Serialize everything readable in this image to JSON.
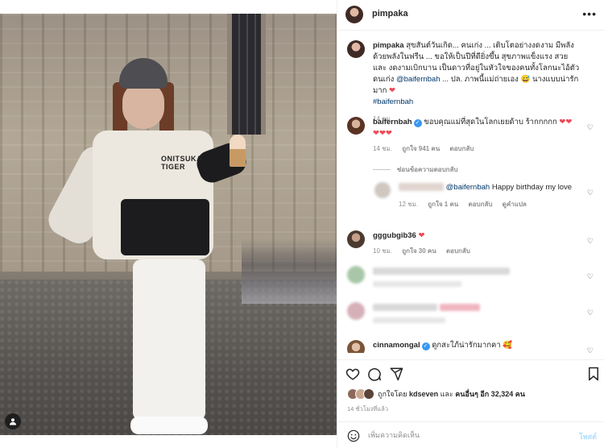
{
  "post": {
    "author": "pimpaka",
    "caption_user": "pimpaka",
    "caption_text": "สุขสันต์วันเกิด... คนเก่ง ... เติบโตอย่างงดงาม มีพลัง ด้วยพลังในฟรีน ... ขอให้เป็นปีที่ดียิ่งขึ้น สุขภาพแข็งแรง สวย และ งดงามเบิกบาน เป็นดาวที่อยู่ในหัวใจของคนทั้งโลกนะไอ้ตัวดนเก่ง",
    "caption_mention": "@baifernbah",
    "caption_tail": "... ปล. ภาพนี้แม่ถ่ายเอง",
    "caption_tail2": "นางแบบน่ารักมาก",
    "caption_hashtag": "#baifernbah",
    "caption_time": "14 ชม."
  },
  "comments": [
    {
      "user": "baifernbah",
      "text": "ขอบคุณแม่ที่สุดในโลกเยยด้าบ ร้ากกกกก",
      "time": "14 ชม.",
      "likes": "ถูกใจ 941 คน",
      "reply": "ตอบกลับ",
      "reply_toggle": "ซ่อนข้อความตอบกลับ"
    },
    {
      "user": "",
      "mention": "@baifernbah",
      "text": "Happy birthday my love",
      "time": "12 ชม.",
      "likes": "ถูกใจ 1 คน",
      "reply": "ตอบกลับ",
      "translate": "ดูคำแปล"
    },
    {
      "user": "gggubgib36",
      "text": "",
      "time": "10 ชม.",
      "likes": "ถูกใจ 30 คน",
      "reply": "ตอบกลับ"
    },
    {
      "user": "cinnamongal",
      "text": "ดูกสะใภ้น่ารักมากคา"
    }
  ],
  "footer": {
    "liked_by_prefix": "ถูกใจโดย",
    "liked_by_user": "kdseven",
    "liked_by_and": "และ",
    "liked_by_others": "คนอื่นๆ อีก 32,324 คน",
    "time": "14 ชั่วโมงที่แล้ว",
    "comment_placeholder": "เพิ่มความคิดเห็น",
    "post_label": "โพสต์"
  },
  "colors": {
    "verified": "#3897f0",
    "heart": "#ed4956",
    "link": "#00376b",
    "post_disabled": "#b2dffc"
  },
  "icons": [
    "more-icon",
    "heart-icon",
    "comment-icon",
    "share-icon",
    "bookmark-icon",
    "emoji-icon",
    "user-tag-icon",
    "verified-badge-icon"
  ]
}
